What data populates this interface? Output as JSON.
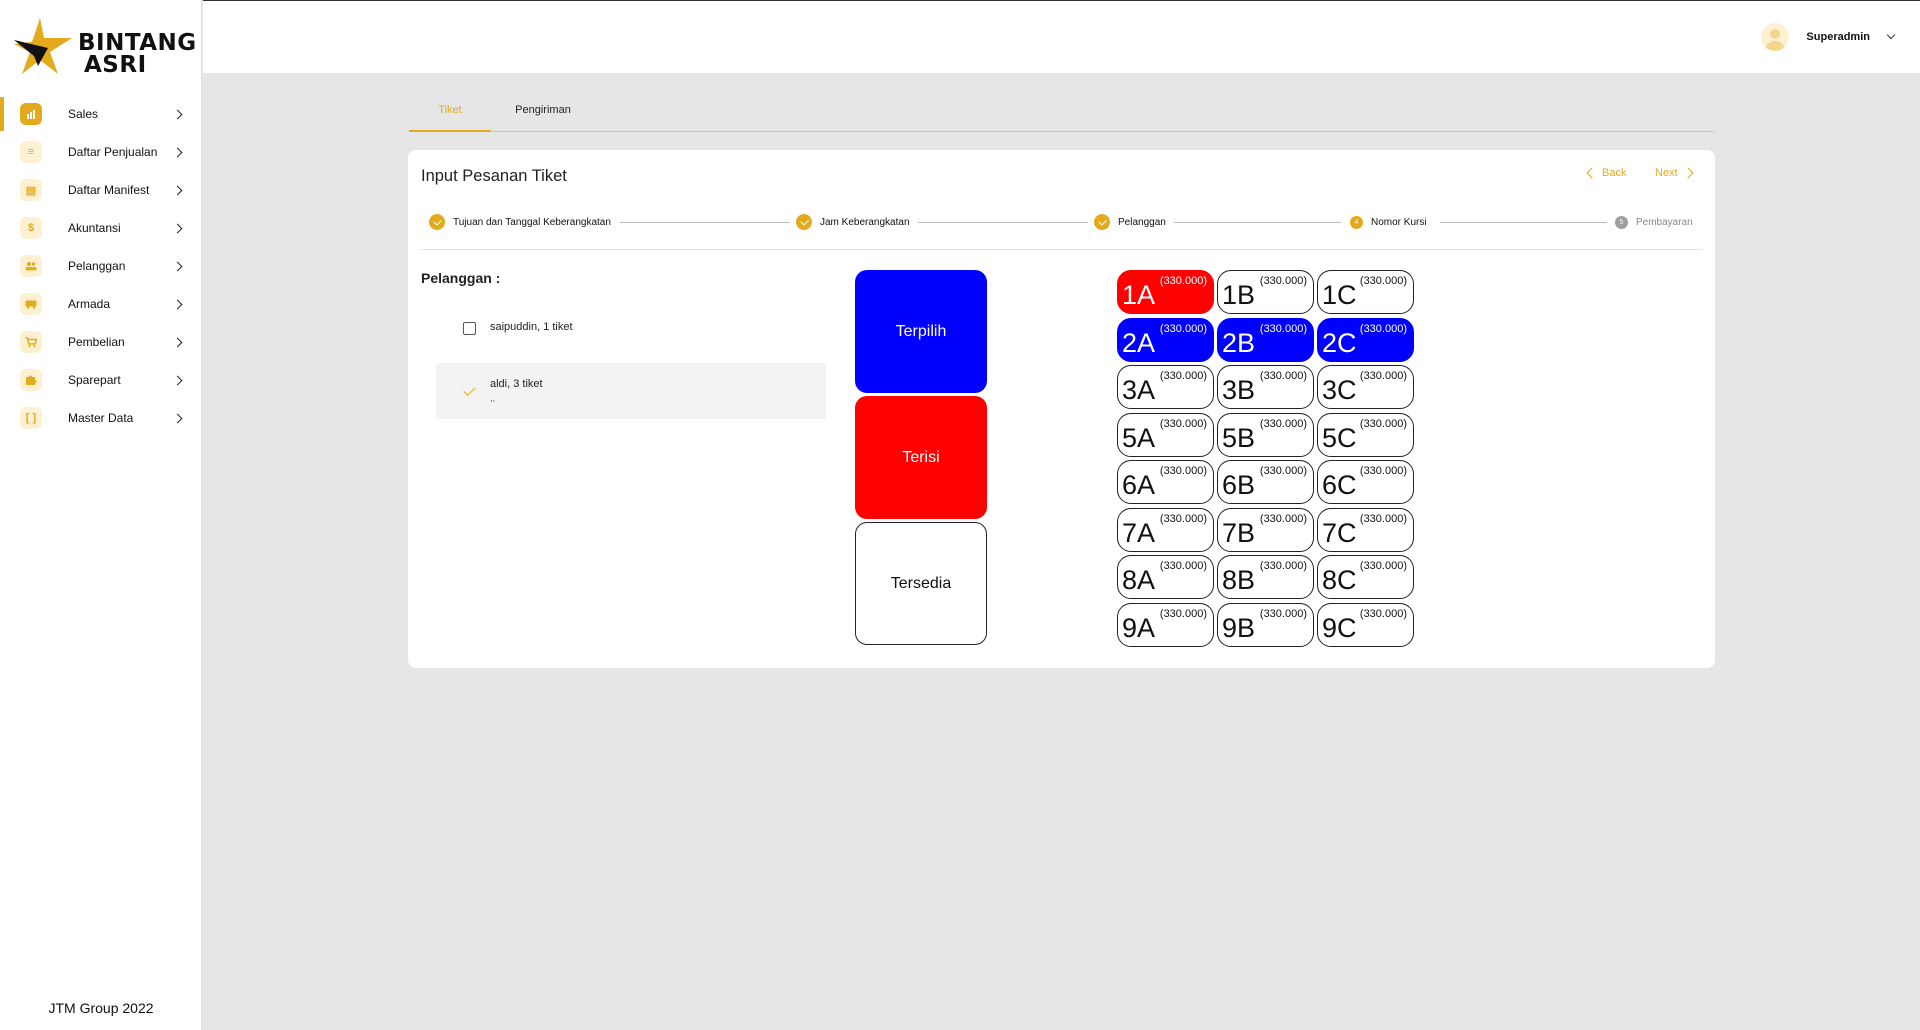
{
  "brand": {
    "name_line1": "BINTANG",
    "name_line2": "ASRI",
    "accent": "#e3aa1b"
  },
  "sidebar": {
    "items": [
      {
        "label": "Sales",
        "icon": "bar-chart-icon",
        "glyph": "▮"
      },
      {
        "label": "Daftar Penjualan",
        "icon": "list-icon",
        "glyph": "≡"
      },
      {
        "label": "Daftar Manifest",
        "icon": "clipboard-icon",
        "glyph": "▤"
      },
      {
        "label": "Akuntansi",
        "icon": "dollar-icon",
        "glyph": "$"
      },
      {
        "label": "Pelanggan",
        "icon": "people-icon",
        "glyph": "👥"
      },
      {
        "label": "Armada",
        "icon": "bus-icon",
        "glyph": "▬"
      },
      {
        "label": "Pembelian",
        "icon": "cart-icon",
        "glyph": "🛒"
      },
      {
        "label": "Sparepart",
        "icon": "puzzle-icon",
        "glyph": "✚"
      },
      {
        "label": "Master Data",
        "icon": "brackets-icon",
        "glyph": "[ ]"
      }
    ],
    "footer": "JTM Group 2022"
  },
  "header": {
    "user_name": "Superadmin"
  },
  "tabs": [
    {
      "label": "Tiket"
    },
    {
      "label": "Pengiriman"
    }
  ],
  "form": {
    "title": "Input Pesanan Tiket",
    "back_label": "Back",
    "next_label": "Next",
    "steps": [
      {
        "label": "Tujuan dan Tanggal Keberangkatan",
        "state": "done"
      },
      {
        "label": "Jam Keberangkatan",
        "state": "done"
      },
      {
        "label": "Pelanggan",
        "state": "done"
      },
      {
        "label": "Nomor Kursi",
        "state": "active",
        "number": "4"
      },
      {
        "label": "Pembayaran",
        "state": "pending",
        "number": "5"
      }
    ],
    "customer_label": "Pelanggan :",
    "customers": [
      {
        "label": "saipuddin, 1 tiket",
        "selected": false,
        "sub": ""
      },
      {
        "label": "aldi, 3 tiket",
        "selected": true,
        "sub": ",,"
      }
    ],
    "legend": {
      "selected": "Terpilih",
      "filled": "Terisi",
      "available": "Tersedia"
    },
    "colors": {
      "selected": "#0000ff",
      "filled": "#ff0000",
      "available": "#ffffff"
    },
    "seats": [
      {
        "code": "1A",
        "price": "(330.000)",
        "status": "filled"
      },
      {
        "code": "1B",
        "price": "(330.000)",
        "status": "available"
      },
      {
        "code": "1C",
        "price": "(330.000)",
        "status": "available"
      },
      {
        "code": "2A",
        "price": "(330.000)",
        "status": "selected"
      },
      {
        "code": "2B",
        "price": "(330.000)",
        "status": "selected"
      },
      {
        "code": "2C",
        "price": "(330.000)",
        "status": "selected"
      },
      {
        "code": "3A",
        "price": "(330.000)",
        "status": "available"
      },
      {
        "code": "3B",
        "price": "(330.000)",
        "status": "available"
      },
      {
        "code": "3C",
        "price": "(330.000)",
        "status": "available"
      },
      {
        "code": "5A",
        "price": "(330.000)",
        "status": "available"
      },
      {
        "code": "5B",
        "price": "(330.000)",
        "status": "available"
      },
      {
        "code": "5C",
        "price": "(330.000)",
        "status": "available"
      },
      {
        "code": "6A",
        "price": "(330.000)",
        "status": "available"
      },
      {
        "code": "6B",
        "price": "(330.000)",
        "status": "available"
      },
      {
        "code": "6C",
        "price": "(330.000)",
        "status": "available"
      },
      {
        "code": "7A",
        "price": "(330.000)",
        "status": "available"
      },
      {
        "code": "7B",
        "price": "(330.000)",
        "status": "available"
      },
      {
        "code": "7C",
        "price": "(330.000)",
        "status": "available"
      },
      {
        "code": "8A",
        "price": "(330.000)",
        "status": "available"
      },
      {
        "code": "8B",
        "price": "(330.000)",
        "status": "available"
      },
      {
        "code": "8C",
        "price": "(330.000)",
        "status": "available"
      },
      {
        "code": "9A",
        "price": "(330.000)",
        "status": "available"
      },
      {
        "code": "9B",
        "price": "(330.000)",
        "status": "available"
      },
      {
        "code": "9C",
        "price": "(330.000)",
        "status": "available"
      }
    ]
  }
}
